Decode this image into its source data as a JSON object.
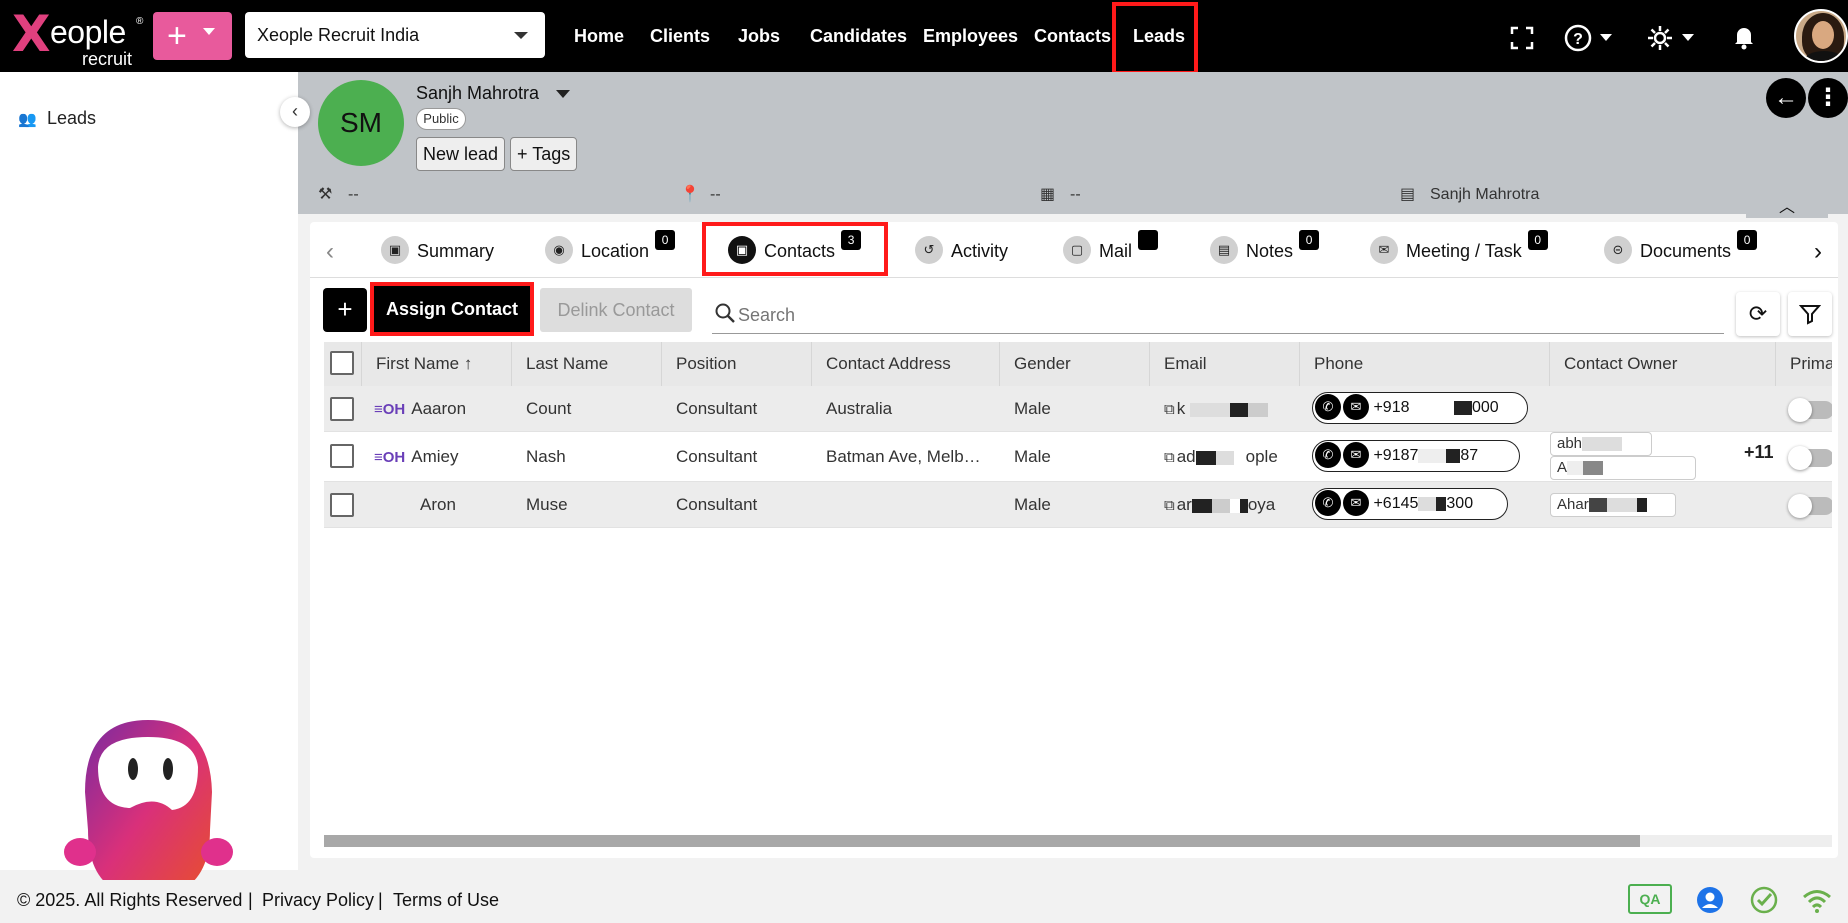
{
  "brand": {
    "logo_word": "eople",
    "logo_x": "X",
    "logo_sub": "recruit",
    "registered": "®"
  },
  "org": {
    "selected": "Xeople Recruit India"
  },
  "nav": [
    "Home",
    "Clients",
    "Jobs",
    "Candidates",
    "Employees",
    "Contacts",
    "Leads"
  ],
  "top_icons": [
    "fullscreen-icon",
    "help-icon",
    "gear-icon",
    "bell-icon"
  ],
  "sidebar": {
    "item_label": "Leads"
  },
  "lead": {
    "initials": "SM",
    "name": "Sanjh Mahrotra",
    "visibility": "Public",
    "status_button": "New lead",
    "tags_button": "Tags",
    "meta": {
      "industry": "--",
      "location": "--",
      "company": "--",
      "owner": "Sanjh Mahrotra"
    }
  },
  "tabs": [
    {
      "label": "Summary",
      "badge": ""
    },
    {
      "label": "Location",
      "badge": "0"
    },
    {
      "label": "Contacts",
      "badge": "3"
    },
    {
      "label": "Activity",
      "badge": ""
    },
    {
      "label": "Mail",
      "badge": ""
    },
    {
      "label": "Notes",
      "badge": "0"
    },
    {
      "label": "Meeting / Task",
      "badge": "0"
    },
    {
      "label": "Documents",
      "badge": "0"
    }
  ],
  "toolbar": {
    "add": "+",
    "assign_label": "Assign Contact",
    "delink_label": "Delink Contact",
    "search_placeholder": "Search"
  },
  "table": {
    "columns": [
      "First Name",
      "Last Name",
      "Position",
      "Contact Address",
      "Gender",
      "Email",
      "Phone",
      "Contact Owner",
      "Prima"
    ],
    "sort_indicator": "↑",
    "oh_tag": "≡OH",
    "rows": [
      {
        "first": "Aaaron",
        "last": "Count",
        "position": "Consultant",
        "address": "Australia",
        "gender": "Male",
        "email": "k",
        "phone_start": "+918",
        "phone_end": "000",
        "owners": [],
        "tag": true
      },
      {
        "first": "Amiey",
        "last": "Nash",
        "position": "Consultant",
        "address": "Batman Ave, Melbourne",
        "gender": "Male",
        "email": "ad",
        "email_end": "ople",
        "phone_start": "+9187",
        "phone_end": "87",
        "owners": [
          "abh",
          "A"
        ],
        "more": "+11",
        "tag": true
      },
      {
        "first": "Aron",
        "last": "Muse",
        "position": "Consultant",
        "address": "",
        "gender": "Male",
        "email": "ar",
        "email_end": "oya",
        "phone_start": "+6145",
        "phone_end": "300",
        "owners": [
          "Ahar"
        ],
        "tag": false
      }
    ]
  },
  "footer": {
    "copyright": "© 2025. All Rights Reserved",
    "sep": "|",
    "privacy": "Privacy Policy",
    "terms": "Terms of Use",
    "qa": "QA"
  },
  "colors": {
    "accent": "#e85a9c",
    "highlight": "#ff1a1a",
    "avatar_green": "#4caf50"
  }
}
